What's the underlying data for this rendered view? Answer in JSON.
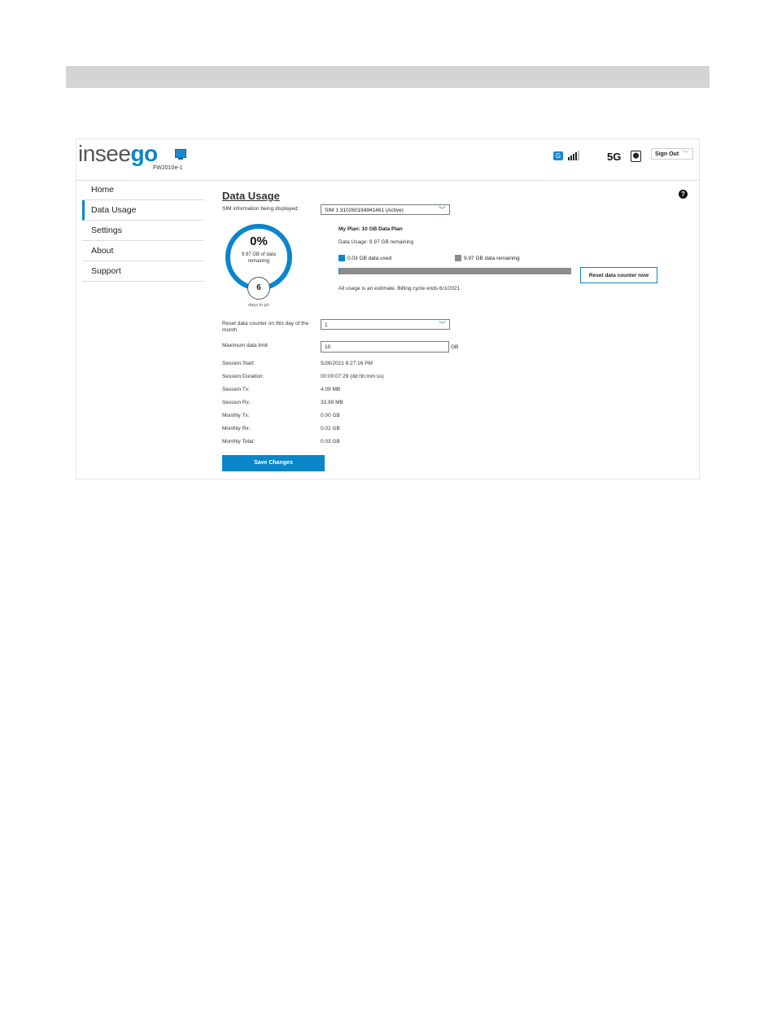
{
  "header": {
    "logo_prefix": "insee",
    "logo_suffix": "go",
    "model": "FW2010e-1",
    "network": "5G",
    "signout_label": "Sign Out",
    "signal_bars": 4,
    "icons": [
      "monitor-icon",
      "g-network-icon",
      "signal-bars-icon",
      "sim-card-icon",
      "chevron-down-icon"
    ]
  },
  "sidebar": {
    "items": [
      {
        "label": "Home",
        "active": false
      },
      {
        "label": "Data Usage",
        "active": true
      },
      {
        "label": "Settings",
        "active": false
      },
      {
        "label": "About",
        "active": false
      },
      {
        "label": "Support",
        "active": false
      }
    ]
  },
  "main": {
    "title": "Data Usage",
    "help": "?",
    "sim_label": "SIM information being displayed:",
    "sim_value": "SIM 1 310260194941461 (Active)",
    "gauge": {
      "percent_text": "0%",
      "remaining_text": "9.97 GB of data remaining",
      "days": "6",
      "days_label": "days to go",
      "used_fraction": 0.003
    },
    "plan": "My Plan: 10 GB Data Plan",
    "usage": "Data Usage: 9.97 GB remaining",
    "legend_used": "0.03 GB data used",
    "legend_remaining": "9.97 GB data remaining",
    "bar_used_fraction": 0.003,
    "reset_button": "Reset data counter now",
    "estimate": "All usage is an estimate. Billing cycle ends 6/1/2021",
    "reset_day_label": "Reset data counter on this day of the month",
    "reset_day_value": "1",
    "max_limit_label": "Maximum data limit",
    "max_limit_value": "10",
    "max_limit_unit": "GB",
    "stats": [
      {
        "label": "Session Start:",
        "value": "5/26/2021 8:27:16 PM"
      },
      {
        "label": "Session Duration:",
        "value": "00:00:07:29 (dd:hh:mm:ss)"
      },
      {
        "label": "Session Tx:",
        "value": "4.09 MB"
      },
      {
        "label": "Session Rx:",
        "value": "33.99 MB"
      },
      {
        "label": "Monthly Tx:",
        "value": "0.00 GB"
      },
      {
        "label": "Monthly Rx:",
        "value": "0.02 GB"
      },
      {
        "label": "Monthly Total:",
        "value": "0.03 GB"
      }
    ],
    "save_button": "Save Changes"
  },
  "colors": {
    "accent": "#0a86c9",
    "remaining": "#8c8c8c"
  }
}
